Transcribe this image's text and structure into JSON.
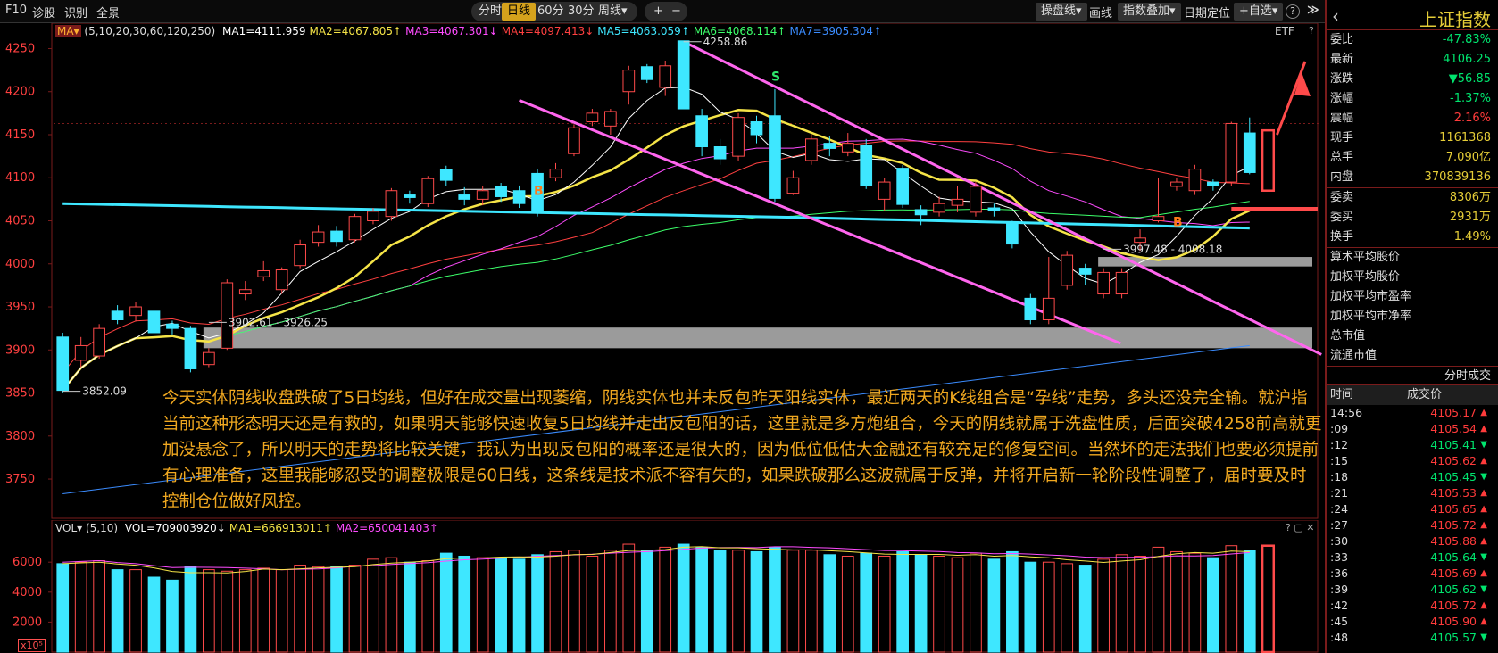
{
  "toolbar": {
    "left_items": [
      "F10",
      "诊股",
      "识别",
      "全景"
    ],
    "periods": [
      "分时",
      "日线",
      "60分",
      "30分",
      "周线▾"
    ],
    "active_period": "日线",
    "zoom_in": "+",
    "zoom_out": "−",
    "right_items": [
      "操盘线▾",
      "画线",
      "指数叠加▾",
      "日期定位",
      "+自选▾"
    ],
    "help": "?",
    "collapse": "≫"
  },
  "ma_legend": {
    "label": "MA▾",
    "params": "(5,10,20,30,60,120,250)",
    "items": [
      {
        "text": "MA1=4111.959",
        "color": "#ffffff"
      },
      {
        "text": "MA2=4067.805↑",
        "color": "#f5e447"
      },
      {
        "text": "MA3=4067.301↓",
        "color": "#ff4cff"
      },
      {
        "text": "MA4=4097.413↓",
        "color": "#ff4040"
      },
      {
        "text": "MA5=4063.059↑",
        "color": "#3ee7ff"
      },
      {
        "text": "MA6=4068.114↑",
        "color": "#3cff6a"
      },
      {
        "text": "MA7=3905.304↑",
        "color": "#3b8cff"
      }
    ],
    "etf": "ETF",
    "help": "?"
  },
  "vol_legend": {
    "label": "VOL▾",
    "params": "(5,10)",
    "items": [
      {
        "text": "VOL=709003920↓",
        "color": "#ffffff"
      },
      {
        "text": "MA1=666913011↑",
        "color": "#f5e447"
      },
      {
        "text": "MA2=650041403↑",
        "color": "#ff4cff"
      }
    ],
    "controls": "? ▢ ✕",
    "multiplier": "x10⁵"
  },
  "chart_data": {
    "type": "candlestick",
    "ylim": [
      3720,
      4265
    ],
    "y_ticks": [
      4250,
      4200,
      4150,
      4100,
      4050,
      4000,
      3950,
      3900,
      3850,
      3800,
      3750
    ],
    "candles": [
      {
        "o": 3915,
        "c": 3853,
        "h": 3920,
        "l": 3850
      },
      {
        "o": 3888,
        "c": 3905,
        "h": 3915,
        "l": 3880
      },
      {
        "o": 3893,
        "c": 3925,
        "h": 3930,
        "l": 3890
      },
      {
        "o": 3945,
        "c": 3935,
        "h": 3952,
        "l": 3930
      },
      {
        "o": 3940,
        "c": 3950,
        "h": 3956,
        "l": 3933
      },
      {
        "o": 3945,
        "c": 3920,
        "h": 3950,
        "l": 3915
      },
      {
        "o": 3930,
        "c": 3925,
        "h": 3934,
        "l": 3918
      },
      {
        "o": 3925,
        "c": 3878,
        "h": 3928,
        "l": 3874
      },
      {
        "o": 3883,
        "c": 3897,
        "h": 3902,
        "l": 3880
      },
      {
        "o": 3902,
        "c": 3978,
        "h": 3982,
        "l": 3900
      },
      {
        "o": 3965,
        "c": 3970,
        "h": 3980,
        "l": 3958
      },
      {
        "o": 3985,
        "c": 3992,
        "h": 4003,
        "l": 3980
      },
      {
        "o": 3970,
        "c": 3993,
        "h": 3996,
        "l": 3965
      },
      {
        "o": 3998,
        "c": 4022,
        "h": 4028,
        "l": 3995
      },
      {
        "o": 4025,
        "c": 4037,
        "h": 4045,
        "l": 4020
      },
      {
        "o": 4038,
        "c": 4026,
        "h": 4044,
        "l": 4020
      },
      {
        "o": 4028,
        "c": 4055,
        "h": 4058,
        "l": 4025
      },
      {
        "o": 4050,
        "c": 4061,
        "h": 4065,
        "l": 4046
      },
      {
        "o": 4055,
        "c": 4085,
        "h": 4088,
        "l": 4050
      },
      {
        "o": 4080,
        "c": 4077,
        "h": 4085,
        "l": 4070
      },
      {
        "o": 4070,
        "c": 4099,
        "h": 4102,
        "l": 4066
      },
      {
        "o": 4110,
        "c": 4097,
        "h": 4114,
        "l": 4090
      },
      {
        "o": 4080,
        "c": 4075,
        "h": 4089,
        "l": 4068
      },
      {
        "o": 4075,
        "c": 4085,
        "h": 4090,
        "l": 4068
      },
      {
        "o": 4090,
        "c": 4078,
        "h": 4094,
        "l": 4072
      },
      {
        "o": 4085,
        "c": 4070,
        "h": 4091,
        "l": 4065
      },
      {
        "o": 4105,
        "c": 4059,
        "h": 4110,
        "l": 4055
      },
      {
        "o": 4100,
        "c": 4110,
        "h": 4117,
        "l": 4096
      },
      {
        "o": 4128,
        "c": 4158,
        "h": 4162,
        "l": 4125
      },
      {
        "o": 4165,
        "c": 4175,
        "h": 4180,
        "l": 4160
      },
      {
        "o": 4160,
        "c": 4177,
        "h": 4180,
        "l": 4150
      },
      {
        "o": 4200,
        "c": 4225,
        "h": 4230,
        "l": 4185
      },
      {
        "o": 4229,
        "c": 4214,
        "h": 4232,
        "l": 4210
      },
      {
        "o": 4205,
        "c": 4230,
        "h": 4236,
        "l": 4195
      },
      {
        "o": 4259,
        "c": 4180,
        "h": 4259,
        "l": 4180
      },
      {
        "o": 4172,
        "c": 4136,
        "h": 4180,
        "l": 4125
      },
      {
        "o": 4136,
        "c": 4122,
        "h": 4145,
        "l": 4115
      },
      {
        "o": 4125,
        "c": 4170,
        "h": 4175,
        "l": 4120
      },
      {
        "o": 4165,
        "c": 4150,
        "h": 4172,
        "l": 4140
      },
      {
        "o": 4172,
        "c": 4076,
        "h": 4203,
        "l": 4072
      },
      {
        "o": 4082,
        "c": 4100,
        "h": 4108,
        "l": 4080
      },
      {
        "o": 4120,
        "c": 4145,
        "h": 4150,
        "l": 4115
      },
      {
        "o": 4140,
        "c": 4134,
        "h": 4148,
        "l": 4125
      },
      {
        "o": 4130,
        "c": 4140,
        "h": 4152,
        "l": 4125
      },
      {
        "o": 4138,
        "c": 4091,
        "h": 4145,
        "l": 4087
      },
      {
        "o": 4075,
        "c": 4095,
        "h": 4100,
        "l": 4062
      },
      {
        "o": 4111,
        "c": 4069,
        "h": 4115,
        "l": 4065
      },
      {
        "o": 4063,
        "c": 4057,
        "h": 4068,
        "l": 4045
      },
      {
        "o": 4060,
        "c": 4070,
        "h": 4078,
        "l": 4055
      },
      {
        "o": 4068,
        "c": 4075,
        "h": 4090,
        "l": 4060
      },
      {
        "o": 4060,
        "c": 4090,
        "h": 4095,
        "l": 4055
      },
      {
        "o": 4065,
        "c": 4062,
        "h": 4070,
        "l": 4055
      },
      {
        "o": 4049,
        "c": 4023,
        "h": 4050,
        "l": 4018
      },
      {
        "o": 3960,
        "c": 3935,
        "h": 3965,
        "l": 3930
      },
      {
        "o": 3935,
        "c": 3960,
        "h": 4008,
        "l": 3930
      },
      {
        "o": 3975,
        "c": 4010,
        "h": 4015,
        "l": 3970
      },
      {
        "o": 3995,
        "c": 3988,
        "h": 4000,
        "l": 3975
      },
      {
        "o": 3965,
        "c": 3990,
        "h": 3995,
        "l": 3960
      },
      {
        "o": 3965,
        "c": 3990,
        "h": 3995,
        "l": 3960
      },
      {
        "o": 4025,
        "c": 4030,
        "h": 4040,
        "l": 4015
      },
      {
        "o": 4050,
        "c": 4055,
        "h": 4100,
        "l": 4048
      },
      {
        "o": 4090,
        "c": 4095,
        "h": 4100,
        "l": 4085
      },
      {
        "o": 4085,
        "c": 4110,
        "h": 4115,
        "l": 4080
      },
      {
        "o": 4095,
        "c": 4091,
        "h": 4098,
        "l": 4085
      },
      {
        "o": 4095,
        "c": 4163,
        "h": 4165,
        "l": 4090
      },
      {
        "o": 4152,
        "c": 4106,
        "h": 4170,
        "l": 4104
      }
    ],
    "channel_lines": [
      {
        "from": [
          34,
          4258
        ],
        "to": [
          66,
          3905
        ]
      },
      {
        "from": [
          25,
          4190
        ],
        "to": [
          55,
          3918
        ]
      }
    ],
    "price_labels": [
      {
        "text": "4258.86",
        "i": 34,
        "v": 4258
      },
      {
        "text": "3852.09",
        "i": 0,
        "v": 3852
      },
      {
        "text": "3902.61 - 3926.25",
        "i": 8,
        "v": 3932
      },
      {
        "text": "3997.48 - 4008.18",
        "i": 57,
        "v": 4017
      }
    ],
    "signals": [
      {
        "text": "B",
        "i": 26,
        "v": 4084,
        "color": "#ff7a1a"
      },
      {
        "text": "S",
        "i": 39,
        "v": 4217,
        "color": "#2ee86b"
      },
      {
        "text": "B",
        "i": 61,
        "v": 4048,
        "color": "#ff7a1a"
      }
    ],
    "volume": [
      59,
      60,
      61,
      55,
      55,
      50,
      48,
      57,
      55,
      54,
      55,
      56,
      55,
      58,
      57,
      57,
      58,
      62,
      63,
      60,
      61,
      66,
      64,
      63,
      63,
      62,
      65,
      67,
      68,
      64,
      68,
      72,
      68,
      70,
      72,
      70,
      68,
      68,
      67,
      70,
      68,
      68,
      65,
      64,
      66,
      64,
      67,
      65,
      64,
      63,
      66,
      62,
      67,
      60,
      60,
      59,
      58,
      62,
      65,
      64,
      70,
      67,
      66,
      63,
      71,
      68
    ],
    "volume_ylim": [
      0,
      75
    ],
    "volume_ticks": [
      6000,
      4000,
      2000
    ]
  },
  "annotation": "今天实体阴线收盘跌破了5日均线，但好在成交量出现萎缩，阴线实体也并未反包昨天阳线实体，最近两天的K线组合是“孕线”走势，多头还没完全输。就沪指当前这种形态明天还是有救的，如果明天能够快速收复5日均线并走出反包阳的话，这里就是多方炮组合，今天的阴线就属于洗盘性质，后面突破4258前高就更加没悬念了，所以明天的走势将比较关键，我认为出现反包阳的概率还是很大的，因为低位低估大金融还有较充足的修复空间。当然坏的走法我们也要必须提前有心理准备，这里我能够忍受的调整极限是60日线，这条线是技术派不容有失的，如果跌破那么这波就属于反弹，并将开启新一轮阶段性调整了，届时要及时控制仓位做好风控。",
  "right_panel": {
    "back": "‹",
    "title": "上证指数",
    "rows1": [
      {
        "label": "委比",
        "value": "-47.83%",
        "cls": "down"
      },
      {
        "label": "最新",
        "value": "4106.25",
        "cls": "down"
      },
      {
        "label": "涨跌",
        "value": "▼56.85",
        "cls": "down"
      },
      {
        "label": "涨幅",
        "value": "-1.37%",
        "cls": "down"
      },
      {
        "label": "震幅",
        "value": "2.16%",
        "cls": "up"
      },
      {
        "label": "现手",
        "value": "1161368",
        "cls": "yellow"
      },
      {
        "label": "总手",
        "value": "7.090亿",
        "cls": "yellow"
      },
      {
        "label": "内盘",
        "value": "370839136",
        "cls": "yellow"
      }
    ],
    "rows2": [
      {
        "label": "委卖",
        "value": "8306万",
        "cls": "yellow"
      },
      {
        "label": "委买",
        "value": "2931万",
        "cls": "yellow"
      },
      {
        "label": "换手",
        "value": "1.49%",
        "cls": "yellow"
      }
    ],
    "stats": [
      "算术平均股价",
      "加权平均股价",
      "加权平均市盈率",
      "加权平均市净率",
      "总市值",
      "流通市值"
    ],
    "trade_title": "分时成交",
    "trade_head": [
      "时间",
      "成交价"
    ],
    "trades": [
      {
        "t": "14:56",
        "p": "4105.17",
        "d": "up"
      },
      {
        "t": ":09",
        "p": "4105.54",
        "d": "up"
      },
      {
        "t": ":12",
        "p": "4105.41",
        "d": "down"
      },
      {
        "t": ":15",
        "p": "4105.62",
        "d": "up"
      },
      {
        "t": ":18",
        "p": "4105.45",
        "d": "down"
      },
      {
        "t": ":21",
        "p": "4105.53",
        "d": "up"
      },
      {
        "t": ":24",
        "p": "4105.65",
        "d": "up"
      },
      {
        "t": ":27",
        "p": "4105.72",
        "d": "up"
      },
      {
        "t": ":30",
        "p": "4105.88",
        "d": "up"
      },
      {
        "t": ":33",
        "p": "4105.64",
        "d": "down"
      },
      {
        "t": ":36",
        "p": "4105.69",
        "d": "up"
      },
      {
        "t": ":39",
        "p": "4105.62",
        "d": "down"
      },
      {
        "t": ":42",
        "p": "4105.72",
        "d": "up"
      },
      {
        "t": ":45",
        "p": "4105.90",
        "d": "up"
      },
      {
        "t": ":48",
        "p": "4105.57",
        "d": "down"
      }
    ]
  }
}
